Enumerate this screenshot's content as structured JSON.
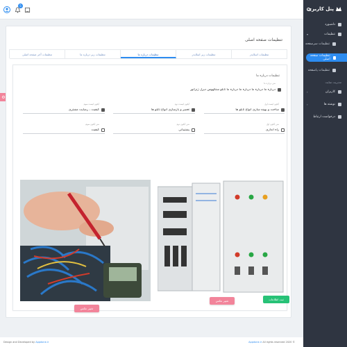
{
  "brand": {
    "name": "پنل کاربری"
  },
  "topbar": {
    "notification_count": "5"
  },
  "sidebar": {
    "items": [
      {
        "label": "داشبورد"
      },
      {
        "label": "تنظیمات"
      },
      {
        "label": "تنظیمات سرصفحه"
      },
      {
        "label": "تنظیمات صفحه اصلی"
      },
      {
        "label": "تنظیمات پاصفحه"
      }
    ],
    "section_label": "مدیریت سایت",
    "items2": [
      {
        "label": "کاربران"
      },
      {
        "label": "نوشته ها"
      },
      {
        "label": "درخواست ارتباط"
      }
    ]
  },
  "page": {
    "title": "تنظیمات صفحه اصلی",
    "tabs": [
      {
        "label": "تنظیمات اسلایدر"
      },
      {
        "label": "تنظیمات زیر اسلایدر"
      },
      {
        "label": "تنظیمات درباره ما"
      },
      {
        "label": "تنظیمات زیر درباره ما"
      },
      {
        "label": "تنظیمات آخر صفحه اصلی"
      }
    ],
    "section_title": "تنظیمات درباره ما",
    "fields": {
      "about_text": {
        "label": "متن درباره ما",
        "value": "درباره ما درباره ما درباره ما درباره ما تابلو ستکهوس دیزل ژنراتور"
      },
      "f1": {
        "label": "آیکون لیست اول",
        "value": "ساخت و بهینه سازی انواع تابلو ها"
      },
      "f2": {
        "label": "آیکون لیست دوم",
        "value": "تعمیر و بازسازی انواع تابلو ها"
      },
      "f3": {
        "label": "آیکون لیست سوم",
        "value": "کیفیت ، رضایت مشتری"
      },
      "f4": {
        "label": "متن آیکون اول",
        "value": "راه اندازی"
      },
      "f5": {
        "label": "متن آیکون دوم",
        "value": "پشتیبانی"
      },
      "f6": {
        "label": "متن آیکون سوم",
        "value": "کیفیت"
      }
    },
    "change_image_label": "تغییر عکس",
    "submit_label": "ثبت اطلاعات"
  },
  "float_tab": {
    "icon": "gear-icon"
  },
  "footer": {
    "left_prefix": "Design and Developed by",
    "left_link": "Appdone.ir",
    "right_link": "Appdone.ir",
    "right_suffix": "All rights reserved 2020 ©"
  }
}
